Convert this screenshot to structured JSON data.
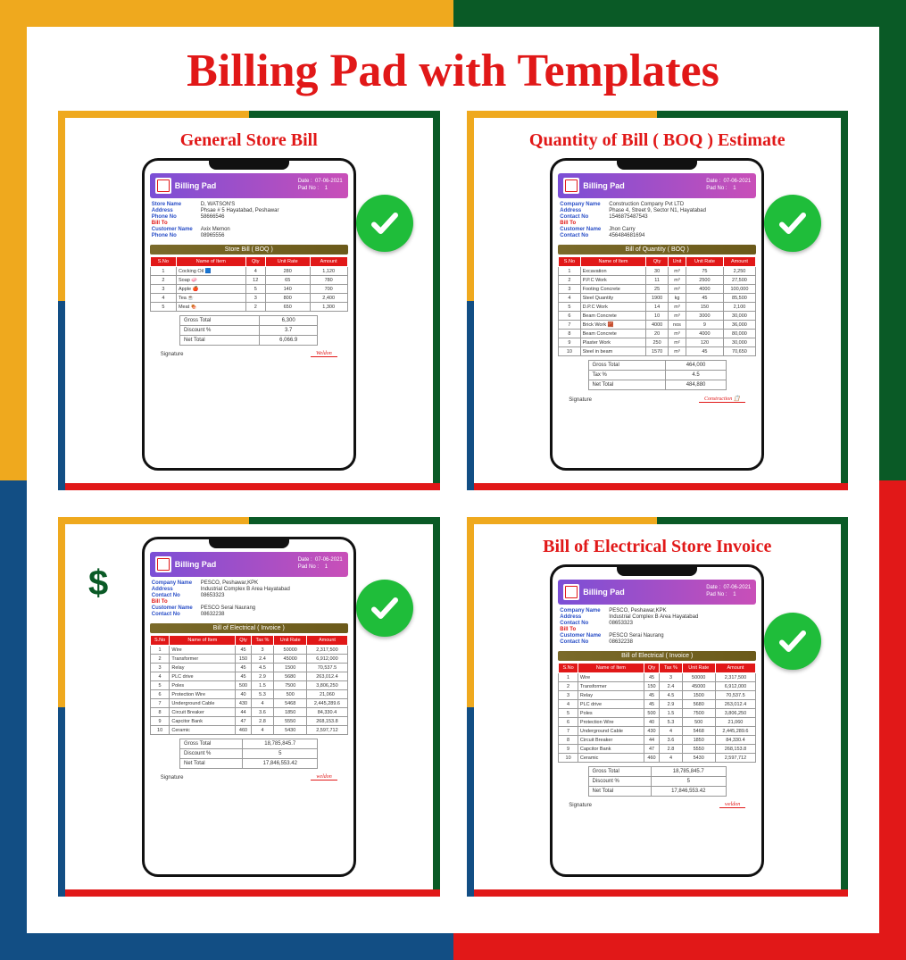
{
  "main_title": "Billing Pad with Templates",
  "dollar": "$",
  "cards": [
    {
      "title": "General Store Bill",
      "app": "Billing Pad",
      "date": "07-06-2021",
      "pad": "1",
      "store": [
        [
          "Store Name",
          "D, WATSON'S"
        ],
        [
          "Address",
          "Phsae # 5 Hayatabad, Peshawar"
        ],
        [
          "Phone No",
          "58666546"
        ]
      ],
      "cust": [
        [
          "Customer Name",
          "Axix Memon"
        ],
        [
          "Phone No",
          "08965556"
        ]
      ],
      "section": "Store Bill ( BOQ )",
      "cols": [
        "S.No",
        "Name of Item",
        "Qty",
        "Unit Rate",
        "Amount"
      ],
      "rows": [
        [
          "1",
          "Cocking Oil 🟦",
          "4",
          "280",
          "1,120"
        ],
        [
          "2",
          "Soap 🧼",
          "12",
          "65",
          "780"
        ],
        [
          "3",
          "Apple 🍎",
          "5",
          "140",
          "700"
        ],
        [
          "4",
          "Tea ☕",
          "3",
          "800",
          "2,400"
        ],
        [
          "5",
          "Meat 🍖",
          "2",
          "650",
          "1,300"
        ]
      ],
      "summary": [
        [
          "Gross Total",
          "6,300"
        ],
        [
          "Discount %",
          "3.7"
        ],
        [
          "Net Total",
          "6,066.9"
        ]
      ],
      "sig": "Weldon",
      "check_pos": "top:82px;right:18px"
    },
    {
      "title": "Quantity of Bill ( BOQ ) Estimate",
      "app": "Billing Pad",
      "date": "07-06-2021",
      "pad": "1",
      "store": [
        [
          "Company Name",
          "Construction Company Pvt LTD"
        ],
        [
          "Address",
          "Phase 4, Street 9, Sector N1, Hayatabad"
        ],
        [
          "Contact No",
          "1546875487543"
        ]
      ],
      "cust": [
        [
          "Customer Name",
          "Jhon Carry"
        ],
        [
          "Contact No",
          "456484681694"
        ]
      ],
      "section": "Bill of Quantity ( BOQ )",
      "cols": [
        "S.No",
        "Name of Item",
        "Qty",
        "Unit",
        "Unit Rate",
        "Amount"
      ],
      "rows": [
        [
          "1",
          "Excavation",
          "30",
          "m³",
          "75",
          "2,250"
        ],
        [
          "2",
          "P.P.C Work",
          "11",
          "m³",
          "2500",
          "27,500"
        ],
        [
          "3",
          "Footing Concrete",
          "25",
          "m³",
          "4000",
          "100,000"
        ],
        [
          "4",
          "Steel Quantity",
          "1900",
          "kg",
          "45",
          "85,500"
        ],
        [
          "5",
          "D.P.C Work",
          "14",
          "m³",
          "150",
          "2,100"
        ],
        [
          "6",
          "Beam Concrete",
          "10",
          "m³",
          "3000",
          "30,000"
        ],
        [
          "7",
          "Brick Work 🧱",
          "4000",
          "nos",
          "9",
          "36,000"
        ],
        [
          "8",
          "Beam Concrete",
          "20",
          "m³",
          "4000",
          "80,000"
        ],
        [
          "9",
          "Plaster Work",
          "250",
          "m²",
          "120",
          "30,000"
        ],
        [
          "10",
          "Steel in beam",
          "1570",
          "m³",
          "45",
          "70,650"
        ]
      ],
      "summary": [
        [
          "Gross Total",
          "464,000"
        ],
        [
          "Tax %",
          "4.5"
        ],
        [
          "Net Total",
          "484,880"
        ]
      ],
      "sig": "Construction 📋",
      "check_pos": "top:82px;right:18px"
    },
    {
      "title": "",
      "app": "Billing Pad",
      "date": "07-06-2021",
      "pad": "1",
      "store": [
        [
          "Company Name",
          "PESCO, Peshawar,KPK"
        ],
        [
          "Address",
          "Industrial Complex B Area Hayatabad"
        ],
        [
          "Contact No",
          "08653323"
        ]
      ],
      "cust": [
        [
          "Customer Name",
          "PESCO Serai Naurang"
        ],
        [
          "Contact No",
          "08632238"
        ]
      ],
      "section": "Bill of Electrical ( Invoice )",
      "cols": [
        "S.No",
        "Name of Item",
        "Qty",
        "Tax %",
        "Unit Rate",
        "Amount"
      ],
      "rows": [
        [
          "1",
          "Wire",
          "45",
          "3",
          "50000",
          "2,317,500"
        ],
        [
          "2",
          "Transformer",
          "150",
          "2.4",
          "45000",
          "6,912,000"
        ],
        [
          "3",
          "Relay",
          "45",
          "4.5",
          "1500",
          "70,537.5"
        ],
        [
          "4",
          "PLC drive",
          "45",
          "2.9",
          "5680",
          "263,012.4"
        ],
        [
          "5",
          "Poles",
          "500",
          "1.5",
          "7500",
          "3,806,250"
        ],
        [
          "6",
          "Protection Wire",
          "40",
          "5.3",
          "500",
          "21,060"
        ],
        [
          "7",
          "Underground Cable",
          "430",
          "4",
          "5468",
          "2,445,289.6"
        ],
        [
          "8",
          "Circuit Breaker",
          "44",
          "3.6",
          "1850",
          "84,330.4"
        ],
        [
          "9",
          "Capcitor Bank",
          "47",
          "2.8",
          "5550",
          "268,153.8"
        ],
        [
          "10",
          "Ceramic",
          "460",
          "4",
          "5430",
          "2,597,712"
        ]
      ],
      "summary": [
        [
          "Gross Total",
          "18,785,845.7"
        ],
        [
          "Discount %",
          "5"
        ],
        [
          "Net Total",
          "17,846,553.42"
        ]
      ],
      "sig": "weldon",
      "check_pos": "top:58px;right:18px",
      "show_dollar": true
    },
    {
      "title": "Bill of Electrical Store Invoice",
      "app": "Billing Pad",
      "date": "07-06-2021",
      "pad": "1",
      "store": [
        [
          "Company Name",
          "PESCO, Peshawar,KPK"
        ],
        [
          "Address",
          "Industrial Complex B Area Hayatabad"
        ],
        [
          "Contact No",
          "08653323"
        ]
      ],
      "cust": [
        [
          "Customer Name",
          "PESCO Serai Naurang"
        ],
        [
          "Contact No",
          "08632238"
        ]
      ],
      "section": "Bill of Electrical ( Invoice )",
      "cols": [
        "S.No",
        "Name of Item",
        "Qty",
        "Tax %",
        "Unit Rate",
        "Amount"
      ],
      "rows": [
        [
          "1",
          "Wire",
          "45",
          "3",
          "50000",
          "2,317,500"
        ],
        [
          "2",
          "Transformer",
          "150",
          "2.4",
          "45000",
          "6,912,000"
        ],
        [
          "3",
          "Relay",
          "45",
          "4.5",
          "1500",
          "70,537.5"
        ],
        [
          "4",
          "PLC drive",
          "45",
          "2.9",
          "5680",
          "263,012.4"
        ],
        [
          "5",
          "Poles",
          "500",
          "1.5",
          "7500",
          "3,806,250"
        ],
        [
          "6",
          "Protection Wire",
          "40",
          "5.3",
          "500",
          "21,060"
        ],
        [
          "7",
          "Underground Cable",
          "430",
          "4",
          "5468",
          "2,445,289.6"
        ],
        [
          "8",
          "Circuit Breaker",
          "44",
          "3.6",
          "1850",
          "84,330.4"
        ],
        [
          "9",
          "Capcitor Bank",
          "47",
          "2.8",
          "5550",
          "268,153.8"
        ],
        [
          "10",
          "Ceramic",
          "460",
          "4",
          "5430",
          "2,597,712"
        ]
      ],
      "summary": [
        [
          "Gross Total",
          "18,785,845.7"
        ],
        [
          "Discount %",
          "5"
        ],
        [
          "Net Total",
          "17,846,553.42"
        ]
      ],
      "sig": "weldon",
      "check_pos": "top:95px;right:18px"
    }
  ]
}
